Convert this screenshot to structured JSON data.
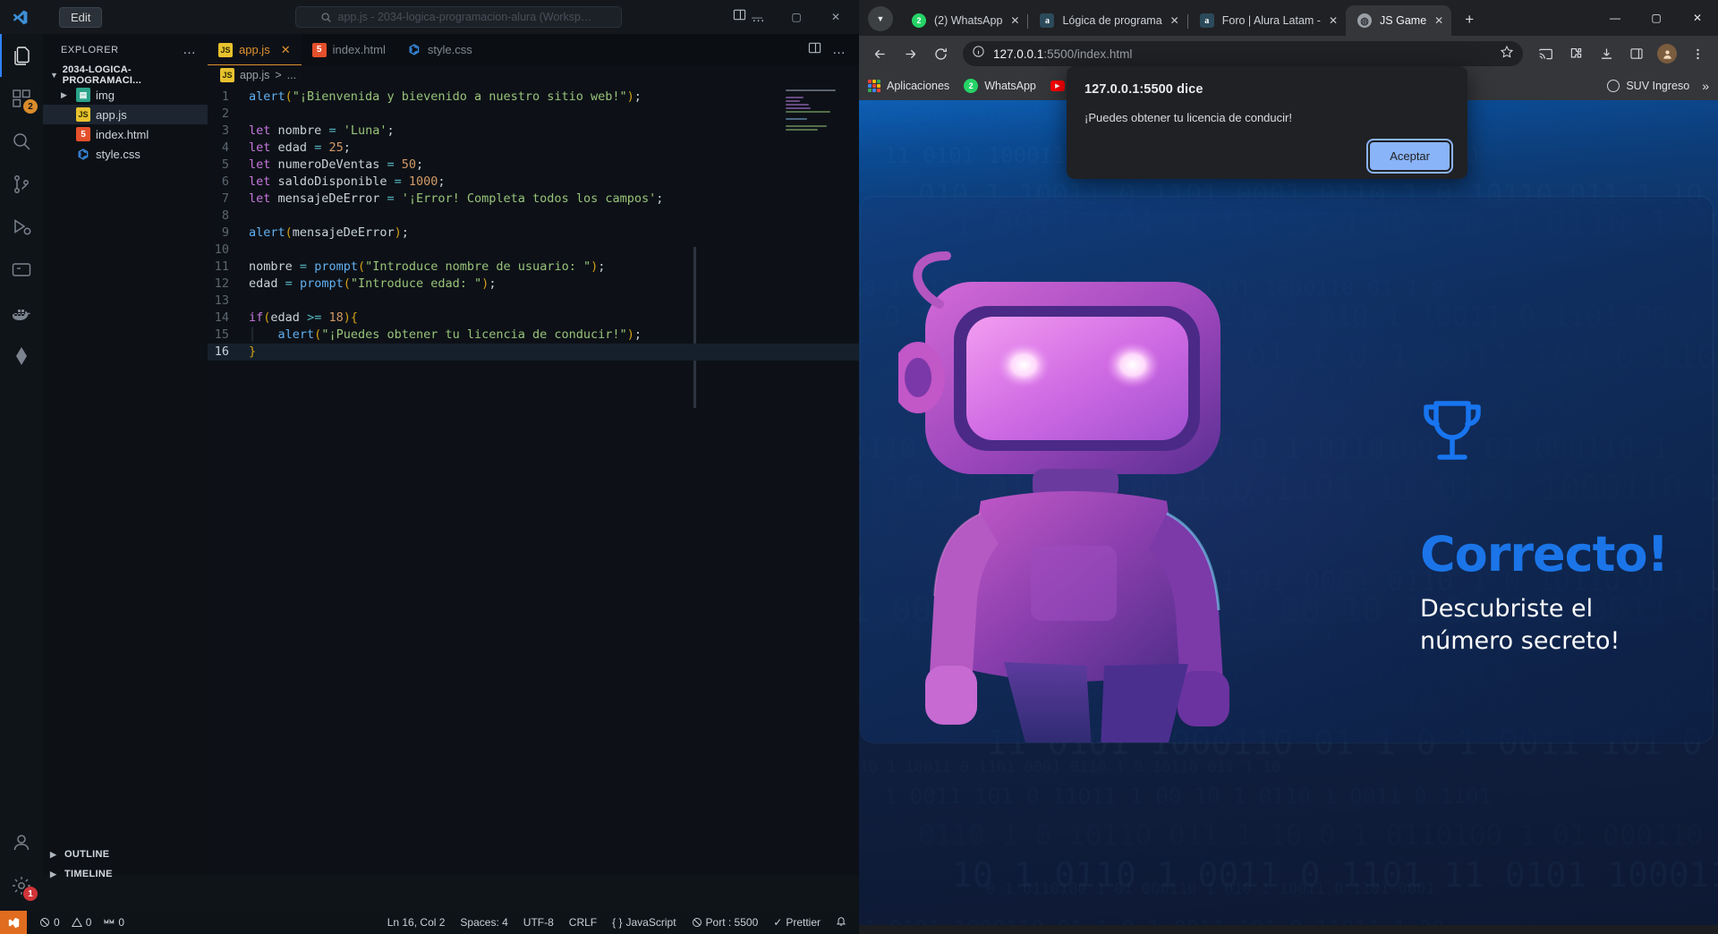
{
  "vscode": {
    "menu_label": "Edit",
    "search_placeholder": "app.js - 2034-logica-programacion-alura (Workspace)",
    "explorer_title": "EXPLORER",
    "explorer_more": "…",
    "project_root": "2034-LOGICA-PROGRAMACI...",
    "tree": [
      {
        "label": "img",
        "icon": "folder-img-icon",
        "type": "folder",
        "selected": false
      },
      {
        "label": "app.js",
        "icon": "js-file-icon",
        "type": "file",
        "selected": true
      },
      {
        "label": "index.html",
        "icon": "html-file-icon",
        "type": "file",
        "selected": false
      },
      {
        "label": "style.css",
        "icon": "css-file-icon",
        "type": "file",
        "selected": false
      }
    ],
    "bottom_sections": [
      "OUTLINE",
      "TIMELINE"
    ],
    "tabs": [
      {
        "label": "app.js",
        "icon": "js-file-icon",
        "active": true,
        "close": "✕"
      },
      {
        "label": "index.html",
        "icon": "html-file-icon",
        "active": false,
        "close": ""
      },
      {
        "label": "style.css",
        "icon": "css-file-icon",
        "active": false,
        "close": ""
      }
    ],
    "breadcrumb": {
      "file": "app.js",
      "separator": ">",
      "tail": "..."
    },
    "activity_badges": {
      "explorer_badge": "",
      "extensions_badge": "2",
      "accounts_badge": "1"
    },
    "code_lines": [
      {
        "n": 1,
        "text": "alert(\"¡Bienvenida y bievenido a nuestro sitio web!\");"
      },
      {
        "n": 2,
        "text": ""
      },
      {
        "n": 3,
        "text": "let nombre = 'Luna';"
      },
      {
        "n": 4,
        "text": "let edad = 25;"
      },
      {
        "n": 5,
        "text": "let numeroDeVentas = 50;"
      },
      {
        "n": 6,
        "text": "let saldoDisponible = 1000;"
      },
      {
        "n": 7,
        "text": "let mensajeDeError = '¡Error! Completa todos los campos';"
      },
      {
        "n": 8,
        "text": ""
      },
      {
        "n": 9,
        "text": "alert(mensajeDeError);"
      },
      {
        "n": 10,
        "text": ""
      },
      {
        "n": 11,
        "text": "nombre = prompt(\"Introduce nombre de usuario: \");"
      },
      {
        "n": 12,
        "text": "edad = prompt(\"Introduce edad: \");"
      },
      {
        "n": 13,
        "text": ""
      },
      {
        "n": 14,
        "text": "if(edad >= 18){"
      },
      {
        "n": 15,
        "text": "    alert(\"¡Puedes obtener tu licencia de conducir!\");"
      },
      {
        "n": 16,
        "text": "}"
      }
    ],
    "status": {
      "errors": "0",
      "warnings": "0",
      "ports": "0",
      "cursor": "Ln 16, Col 2",
      "spaces": "Spaces: 4",
      "encoding": "UTF-8",
      "eol": "CRLF",
      "language": "JavaScript",
      "live_port": "Port : 5500",
      "formatter": "Prettier"
    }
  },
  "chrome": {
    "tabs": [
      {
        "title": "(2) WhatsApp",
        "favicon": "whatsapp-icon",
        "active": false,
        "close": "✕"
      },
      {
        "title": "Lógica de programa",
        "favicon": "alura-icon",
        "active": false,
        "close": "✕"
      },
      {
        "title": "Foro | Alura Latam -",
        "favicon": "alura-icon",
        "active": false,
        "close": "✕"
      },
      {
        "title": "JS Game",
        "favicon": "js-game-icon",
        "active": true,
        "close": "✕"
      }
    ],
    "new_tab_label": "+",
    "window_controls": {
      "minimize": "—",
      "maximize": "▢",
      "close": "✕"
    },
    "omnibox": {
      "host": "127.0.0.1",
      "rest": ":5500/index.html",
      "security_icon": "info-circle-icon",
      "star_icon": "star-icon"
    },
    "bookmarks": [
      {
        "label": "Aplicaciones",
        "icon": "apps-grid-icon"
      },
      {
        "label": "WhatsApp",
        "icon": "whatsapp-icon"
      },
      {
        "label": "You",
        "icon": "youtube-icon"
      }
    ],
    "bookmarks_right": [
      {
        "label": "SUV Ingreso",
        "icon": "globe-icon"
      },
      {
        "label": "»",
        "icon": "overflow-chevron-icon"
      }
    ]
  },
  "dialog": {
    "title": "127.0.0.1:5500 dice",
    "message": "¡Puedes obtener tu licencia de conducir!",
    "accept_label": "Aceptar"
  },
  "game_page": {
    "heading": "Correcto!",
    "subtitle_line1": "Descubriste el",
    "subtitle_line2": "número secreto!",
    "trophy_icon": "trophy-icon",
    "accent_color": "#1b75e8",
    "background_color": "#0f1f3d"
  }
}
